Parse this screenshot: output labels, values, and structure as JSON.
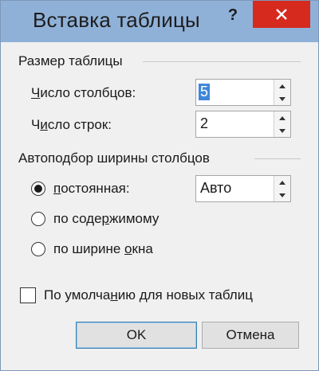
{
  "window": {
    "title": "Вставка таблицы",
    "help": "?"
  },
  "size_section": {
    "title": "Размер таблицы",
    "columns_label_pre": "Ч",
    "columns_label_rest": "исло столбцов:",
    "columns_value": "5",
    "rows_label_pre": "Ч",
    "rows_label_mid": "и",
    "rows_label_rest": "сло строк:",
    "rows_value": "2"
  },
  "autofit_section": {
    "title": "Автоподбор ширины столбцов",
    "options": [
      {
        "label_pre": "",
        "label_u": "п",
        "label_rest": "остоянная:",
        "selected": true
      },
      {
        "label_pre": "по соде",
        "label_u": "р",
        "label_rest": "жимому",
        "selected": false
      },
      {
        "label_pre": "по ширине ",
        "label_u": "о",
        "label_rest": "кна",
        "selected": false
      }
    ],
    "fixed_value": "Авто"
  },
  "default_checkbox": {
    "label_pre": "По умолча",
    "label_u": "н",
    "label_rest": "ию для новых таблиц",
    "checked": false
  },
  "buttons": {
    "ok": "OK",
    "cancel": "Отмена"
  },
  "colors": {
    "titlebar": "#8fb1d8",
    "close": "#d52a1d",
    "selection": "#3f86d9"
  }
}
